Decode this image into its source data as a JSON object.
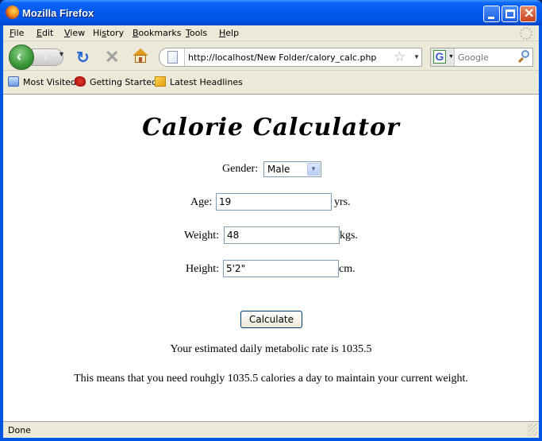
{
  "window": {
    "title": "Mozilla Firefox"
  },
  "menubar": {
    "items": [
      {
        "label": "File",
        "accel": "F",
        "rest": "ile"
      },
      {
        "label": "Edit",
        "accel": "E",
        "rest": "dit"
      },
      {
        "label": "View",
        "accel": "V",
        "rest": "iew"
      },
      {
        "label": "History",
        "pre": "Hi",
        "accel": "s",
        "rest": "tory"
      },
      {
        "label": "Bookmarks",
        "accel": "B",
        "rest": "ookmarks"
      },
      {
        "label": "Tools",
        "accel": "T",
        "rest": "ools"
      },
      {
        "label": "Help",
        "accel": "H",
        "rest": "elp"
      }
    ]
  },
  "navbar": {
    "back_glyph": "‹",
    "forward_glyph": "›",
    "history_dropdown_glyph": "▼",
    "reload_glyph": "↻",
    "stop_glyph": "✕",
    "url": "http://localhost/New Folder/calory_calc.php",
    "star_glyph": "☆",
    "url_dropdown_glyph": "▼",
    "search_engine_glyph": "G",
    "search_dropdown_glyph": "▼",
    "search_placeholder": "Google"
  },
  "bookmarks": {
    "items": [
      {
        "label": "Most Visited",
        "icon": "folder-icon"
      },
      {
        "label": "Getting Started",
        "icon": "firefox-bookmark-icon"
      },
      {
        "label": "Latest Headlines",
        "icon": "rss-icon"
      }
    ]
  },
  "page": {
    "heading": "Calorie Calculator",
    "gender": {
      "label": "Gender:",
      "value": "Male",
      "arrow_glyph": "▾"
    },
    "age": {
      "label": "Age:",
      "value": "19",
      "unit": "yrs."
    },
    "weight": {
      "label": "Weight:",
      "value": "48",
      "unit": "kgs."
    },
    "height": {
      "label": "Height:",
      "value": "5'2\"",
      "unit": "cm."
    },
    "calculate_label": "Calculate",
    "result_line1": "Your estimated daily metabolic rate is 1035.5",
    "result_line2": "This means that you need rouhgly 1035.5 calories a day to maintain your current weight."
  },
  "status": {
    "text": "Done"
  }
}
